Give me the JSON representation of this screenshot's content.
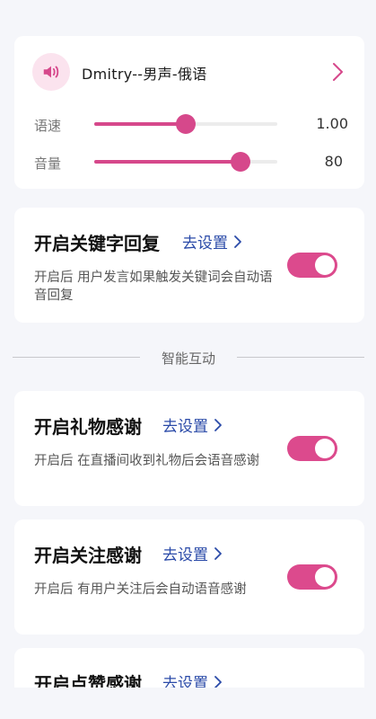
{
  "voice": {
    "name": "Dmitry--男声-俄语",
    "speed_label": "语速",
    "speed_value": "1.00",
    "speed_fraction": 0.5,
    "volume_label": "音量",
    "volume_value": "80",
    "volume_fraction": 0.8
  },
  "features": [
    {
      "title": "开启关键字回复",
      "link": "去设置",
      "desc": "开启后 用户发言如果触发关键词会自动语音回复",
      "enabled": true
    },
    {
      "title": "开启礼物感谢",
      "link": "去设置",
      "desc": "开启后 在直播间收到礼物后会语音感谢",
      "enabled": true
    },
    {
      "title": "开启关注感谢",
      "link": "去设置",
      "desc": "开启后 有用户关注后会自动语音感谢",
      "enabled": true
    },
    {
      "title": "开启点赞感谢",
      "link": "去设置"
    }
  ],
  "section_divider": "智能互动",
  "colors": {
    "accent": "#dc4a8d",
    "link": "#2a4aa8",
    "background": "#f5f6fa"
  }
}
